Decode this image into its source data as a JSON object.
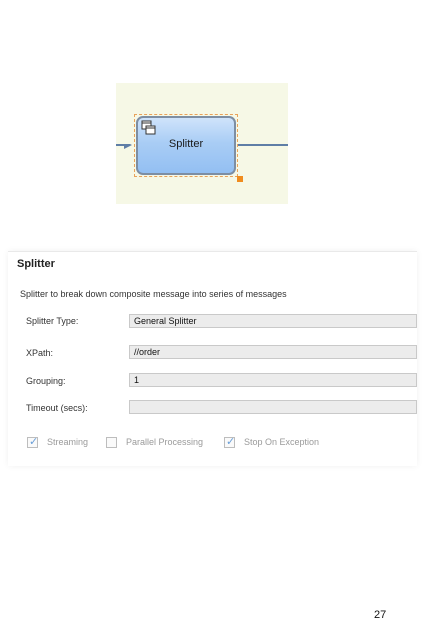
{
  "diagram": {
    "node_label": "Splitter",
    "node_icon": "splitter-icon",
    "colors": {
      "canvas": "#f6f8e6",
      "node_fill": "#a9cdf5",
      "connector": "#5f7ea6",
      "selection": "#e8a25a",
      "handle": "#f08c1e"
    }
  },
  "panel": {
    "title": "Splitter",
    "description": "Splitter to break down composite message into series of messages",
    "fields": [
      {
        "label": "Splitter Type:",
        "value": "General Splitter"
      },
      {
        "label": "XPath:",
        "value": "//order"
      },
      {
        "label": "Grouping:",
        "value": "1"
      },
      {
        "label": "Timeout (secs):",
        "value": ""
      }
    ],
    "checkboxes": [
      {
        "label": "Streaming",
        "checked": true
      },
      {
        "label": "Parallel Processing",
        "checked": false
      },
      {
        "label": "Stop On Exception",
        "checked": true
      }
    ]
  },
  "page_number": "27"
}
